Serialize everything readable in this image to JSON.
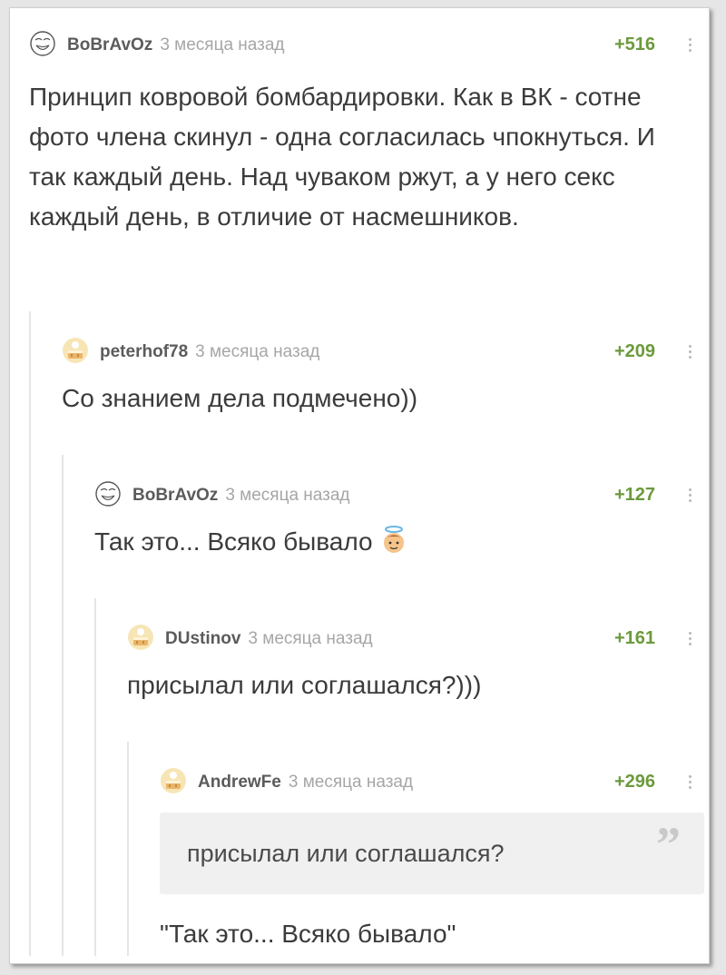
{
  "comments": [
    {
      "user": "BoBrAvOz",
      "time": "3 месяца назад",
      "rating": "+516",
      "text": "Принцип ковровой бомбардировки. Как в ВК - сотне фото члена скинул - одна согласилась чпокнуться. И так каждый день. Над чуваком ржут, а у него секс каждый день, в отличие от насмешников.",
      "avatar_icon": "troll-face-icon"
    },
    {
      "user": "peterhof78",
      "time": "3 месяца назад",
      "rating": "+209",
      "text": "Со знанием дела подмечено))",
      "avatar_icon": "default-cake-avatar-icon"
    },
    {
      "user": "BoBrAvOz",
      "time": "3 месяца назад",
      "rating": "+127",
      "text": "Так это... Всяко бывало",
      "avatar_icon": "troll-face-icon",
      "emoji": "angel-face-emoji"
    },
    {
      "user": "DUstinov",
      "time": "3 месяца назад",
      "rating": "+161",
      "text": "присылал или соглашался?)))",
      "avatar_icon": "default-cake-avatar-icon"
    },
    {
      "user": "AndrewFe",
      "time": "3 месяца назад",
      "rating": "+296",
      "quote": "присылал или соглашался?",
      "text": "\"Так это... Всяко бывало\"",
      "avatar_icon": "default-cake-avatar-icon"
    }
  ],
  "colors": {
    "rating": "#6c9a3c",
    "username": "#5b5b5b",
    "time": "#a6a6a6",
    "text": "#3b3b3b",
    "quote_bg": "#f0f0f0"
  }
}
